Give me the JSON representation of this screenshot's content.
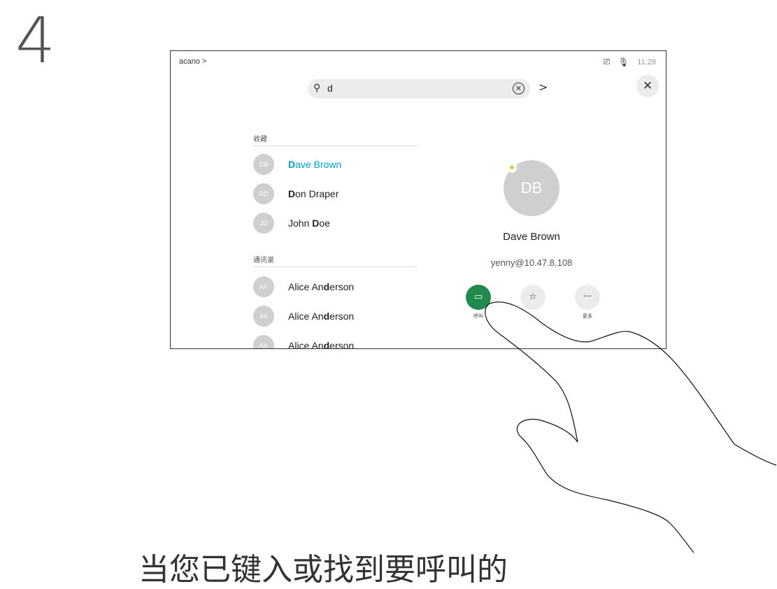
{
  "step_number": "4",
  "device": {
    "breadcrumb": "acano >",
    "status": {
      "time": "11:28",
      "screen_icon": "screen-share-icon",
      "mic_icon": "mic-muted-icon"
    },
    "search": {
      "value": "d",
      "search_icon": "search-icon",
      "clear_icon": "clear-icon",
      "next_label": ">"
    },
    "close_icon": "close-icon",
    "favorites": {
      "heading": "收藏",
      "items": [
        {
          "initials": "DB",
          "name_bold": "D",
          "name_rest": "ave Brown",
          "highlighted": true
        },
        {
          "initials": "DD",
          "name_bold": "D",
          "name_rest": "on Draper",
          "highlighted": false
        },
        {
          "initials": "JD",
          "name_prefix": "John ",
          "name_bold": "D",
          "name_rest": "oe",
          "highlighted": false
        }
      ]
    },
    "directory": {
      "heading": "通讯录",
      "items": [
        {
          "initials": "AA",
          "prefix": "Alice An",
          "bold": "d",
          "rest": "erson"
        },
        {
          "initials": "AA",
          "prefix": "Alice An",
          "bold": "d",
          "rest": "erson"
        },
        {
          "initials": "AA",
          "prefix": "Alice An",
          "bold": "d",
          "rest": "erson"
        }
      ]
    },
    "detail": {
      "initials": "DB",
      "name": "Dave Brown",
      "address": "yenny@10.47.8.108",
      "favorite": true,
      "actions": [
        {
          "icon": "video-call-icon",
          "label": "呼叫",
          "color": "#1f8a4c"
        },
        {
          "icon": "star-icon",
          "label": "",
          "color": "#ececec"
        },
        {
          "icon": "more-icon",
          "label": "更多",
          "color": "#ececec"
        }
      ]
    }
  },
  "caption": "当您已键入或找到要呼叫的"
}
